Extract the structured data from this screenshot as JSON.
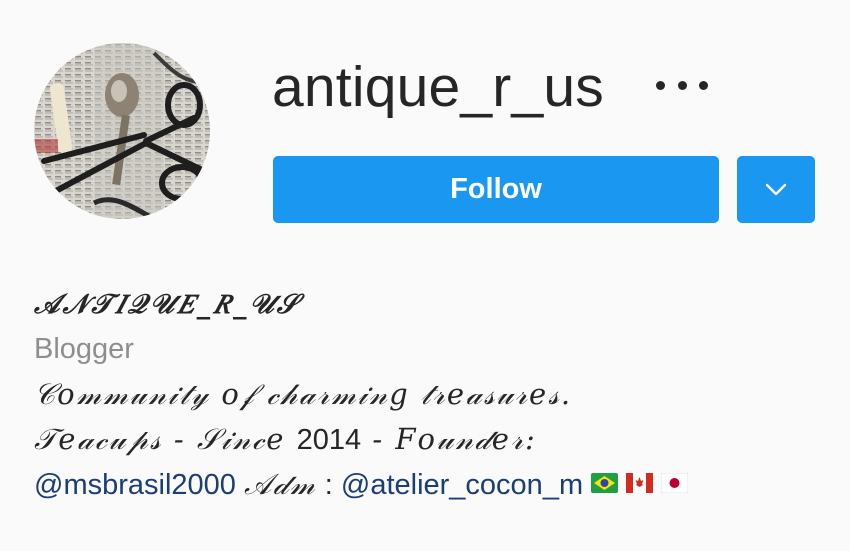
{
  "profile": {
    "username": "antique_r_us",
    "more_options_icon": "ellipsis-icon",
    "avatar_alt": "avatar"
  },
  "actions": {
    "follow_label": "Follow",
    "dropdown_icon": "chevron-down-icon",
    "accent_color": "#1a97f0"
  },
  "bio": {
    "full_name": "𝒜𝒩𝒯𝐼𝒬𝒰𝐸_𝑅_𝒰𝒮",
    "category": "Blogger",
    "line1": "𝒞𝑜𝓂𝓂𝓊𝓃𝒾𝓉𝓎 𝑜𝒻 𝒸𝒽𝒶𝓇𝓂𝒾𝓃𝑔 𝓉𝓇𝑒𝒶𝓈𝓊𝓇𝑒𝓈.",
    "line2_script_a": "𝒯𝑒𝒶𝒸𝓊𝓅𝓈 - 𝒮𝒾𝓃𝒸𝑒",
    "line2_year": "2014",
    "line2_script_b": "- 𝐹𝑜𝓊𝓃𝒹𝑒𝓇:",
    "mention1": "@msbrasil2000",
    "line3_script": "𝒜𝒹𝓂",
    "line3_sep": ":",
    "mention2": "@atelier_cocon_m",
    "flags": [
      "brazil-flag-icon",
      "canada-flag-icon",
      "japan-flag-icon"
    ],
    "mention_color": "#1b3e73"
  }
}
